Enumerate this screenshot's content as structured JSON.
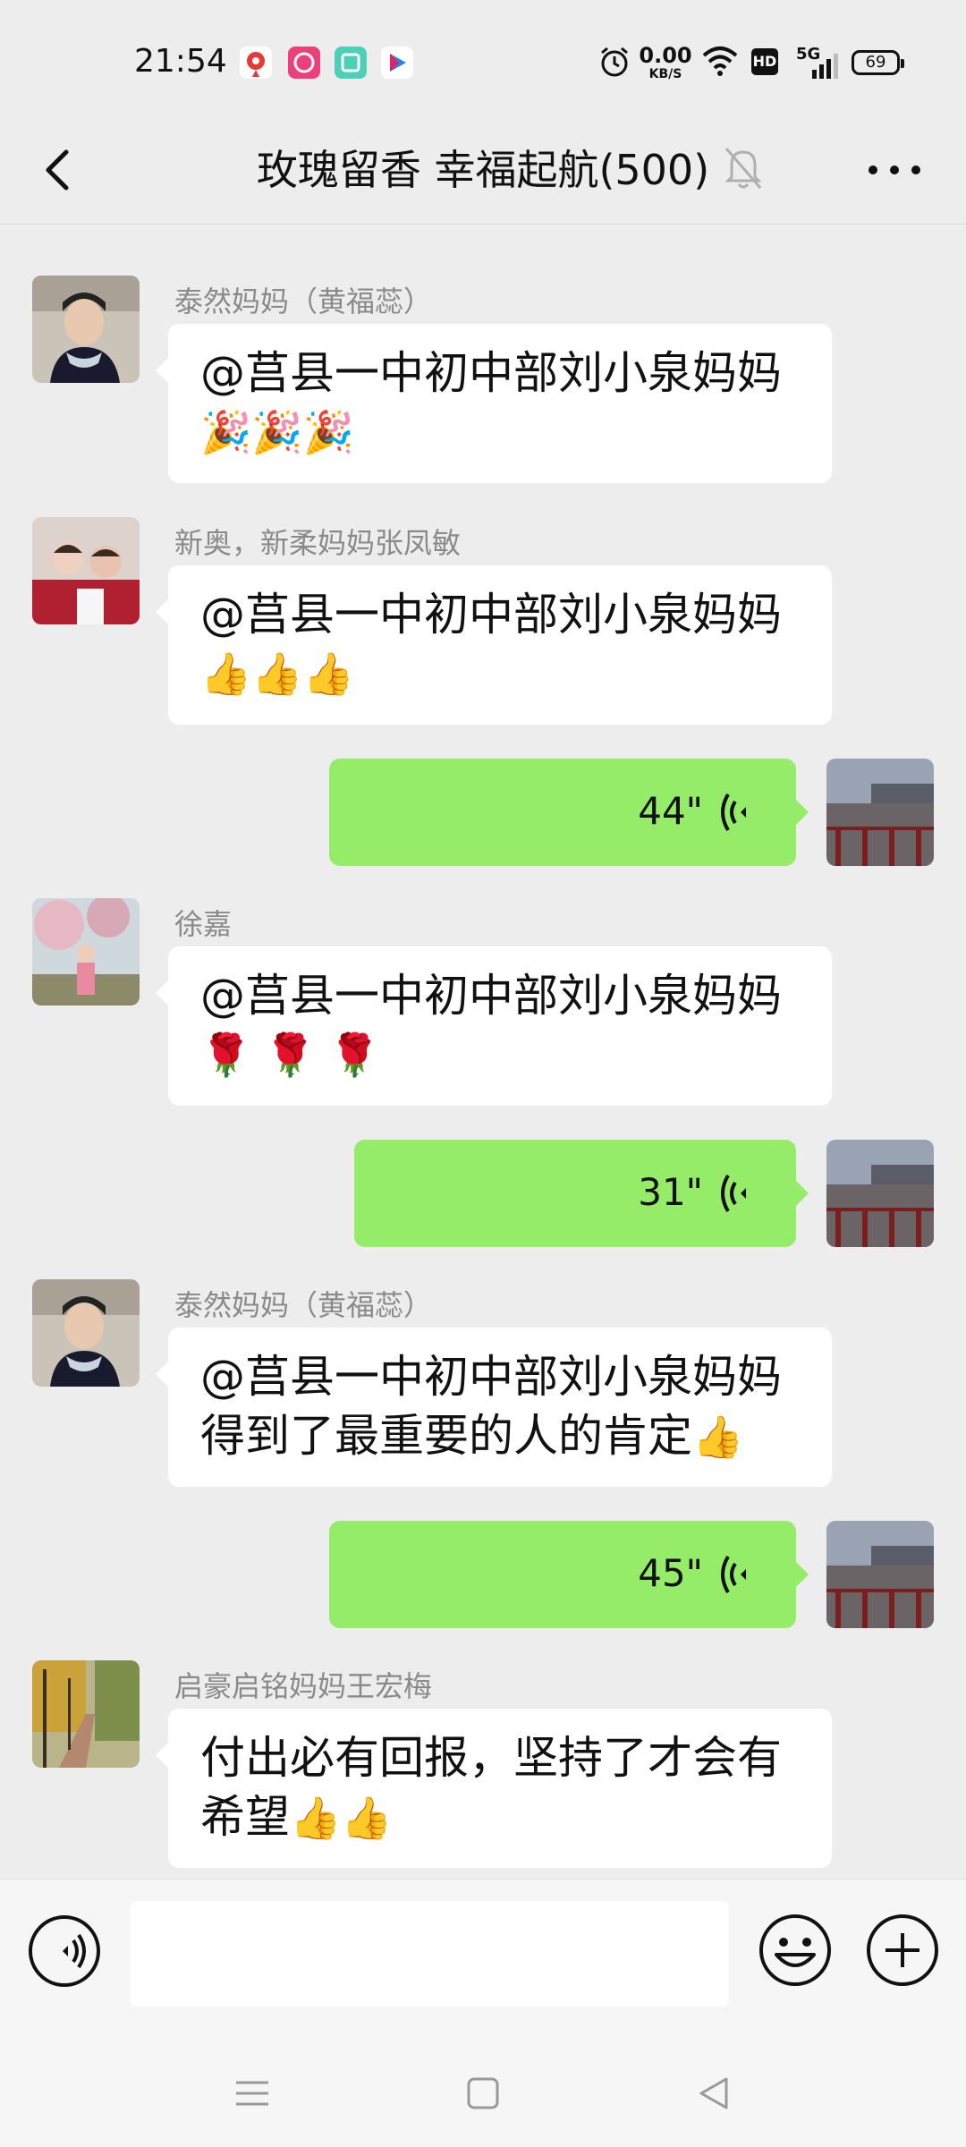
{
  "status_bar": {
    "time": "21:54",
    "net_speed_value": "0.00",
    "net_speed_unit": "KB/S",
    "hd_label": "HD",
    "signal_label": "5G",
    "battery": "69"
  },
  "header": {
    "title": "玫瑰留香  幸福起航(500)"
  },
  "messages": [
    {
      "sender": "泰然妈妈（黄福蕊）",
      "text": "@莒县一中初中部刘小泉妈妈",
      "emoji": "🎉🎉🎉"
    },
    {
      "sender": "新奥，新柔妈妈张凤敏",
      "text": "@莒县一中初中部刘小泉妈妈",
      "emoji": "👍👍👍"
    },
    {
      "duration": "44\""
    },
    {
      "sender": "徐嘉",
      "text": "@莒县一中初中部刘小泉妈妈",
      "emoji": "🌹 🌹 🌹"
    },
    {
      "duration": "31\""
    },
    {
      "sender": "泰然妈妈（黄福蕊）",
      "text": "@莒县一中初中部刘小泉妈妈",
      "text2": "得到了最重要的人的肯定",
      "emoji": "👍"
    },
    {
      "duration": "45\""
    },
    {
      "sender": "启豪启铭妈妈王宏梅",
      "text": "付出必有回报，坚持了才会有",
      "text2": "希望",
      "emoji": "👍👍"
    }
  ],
  "input": {
    "placeholder": ""
  },
  "icons": {
    "back": "chevron-left-icon",
    "mute": "bell-off-icon",
    "more": "more-icon",
    "voice": "voice-icon",
    "emoji": "emoji-icon",
    "plus": "plus-icon"
  },
  "colors": {
    "outgoing_bubble": "#95ec69",
    "incoming_bubble": "#ffffff",
    "background": "#ededed"
  }
}
